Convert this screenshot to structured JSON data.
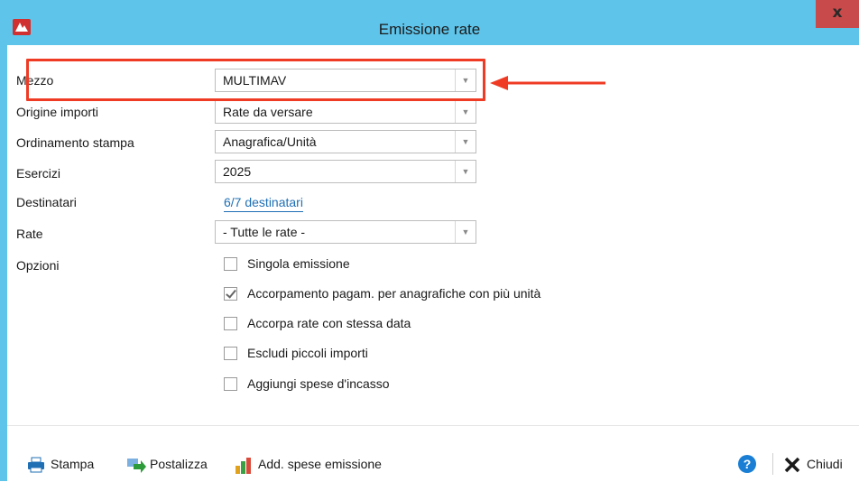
{
  "window": {
    "title": "Emissione rate",
    "close_label": "x"
  },
  "form": {
    "mezzo": {
      "label": "Mezzo",
      "value": "MULTIMAV"
    },
    "origine": {
      "label": "Origine importi",
      "value": "Rate da versare"
    },
    "ordinamento": {
      "label": "Ordinamento stampa",
      "value": "Anagrafica/Unità"
    },
    "esercizi": {
      "label": "Esercizi",
      "value": "2025"
    },
    "destinatari": {
      "label": "Destinatari",
      "link": "6/7 destinatari"
    },
    "rate": {
      "label": "Rate",
      "value": "- Tutte le rate -"
    },
    "opzioni": {
      "label": "Opzioni",
      "items": [
        {
          "label": "Singola emissione",
          "checked": false
        },
        {
          "label": "Accorpamento pagam. per anagrafiche con più unità",
          "checked": true
        },
        {
          "label": "Accorpa rate con stessa data",
          "checked": false
        },
        {
          "label": "Escludi piccoli importi",
          "checked": false
        },
        {
          "label": "Aggiungi spese d'incasso",
          "checked": false
        }
      ]
    }
  },
  "toolbar": {
    "stampa": "Stampa",
    "postalizza": "Postalizza",
    "add_spese": "Add. spese emissione",
    "help": "?",
    "chiudi": "Chiudi"
  },
  "colors": {
    "titlebar": "#5ec4ea",
    "highlight": "#ef3b24",
    "link": "#1f6fb5",
    "close": "#c94a4a"
  }
}
